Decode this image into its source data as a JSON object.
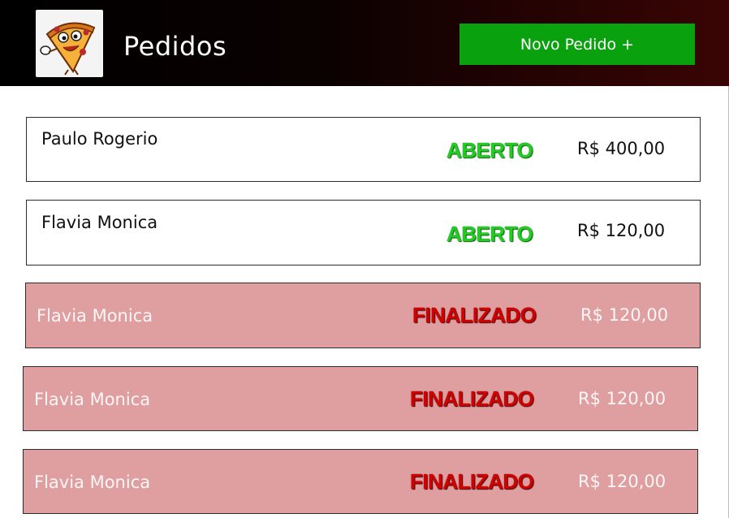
{
  "header": {
    "title": "Pedidos",
    "new_order_label": "Novo Pedido +",
    "logo_icon": "pizza-mascot-logo"
  },
  "colors": {
    "header_bg": "#000000",
    "button_bg": "#09a10d",
    "open_status": "#22cc22",
    "done_status": "#d40000",
    "done_row_bg": "#df9ea0"
  },
  "orders": [
    {
      "name": "Paulo Rogerio",
      "status": "ABERTO",
      "price": "R$ 400,00"
    },
    {
      "name": "Flavia Monica",
      "status": "ABERTO",
      "price": "R$ 120,00"
    },
    {
      "name": "Flavia Monica",
      "status": "FINALIZADO",
      "price": "R$ 120,00"
    },
    {
      "name": "Flavia Monica",
      "status": "FINALIZADO",
      "price": "R$ 120,00"
    },
    {
      "name": "Flavia Monica",
      "status": "FINALIZADO",
      "price": "R$ 120,00"
    }
  ]
}
